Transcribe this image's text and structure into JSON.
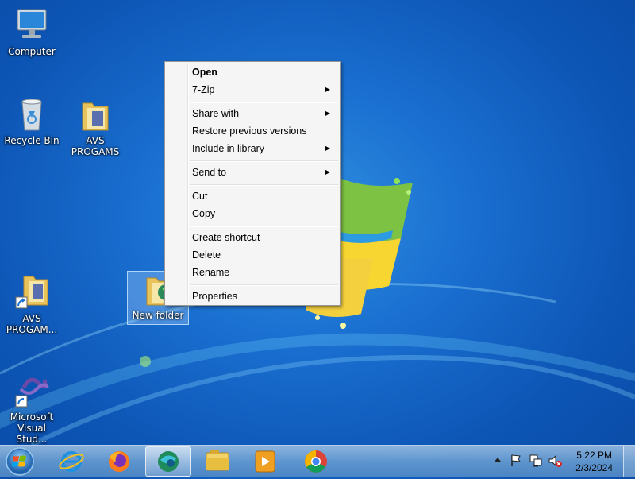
{
  "desktop": {
    "icons": [
      {
        "label": "Computer"
      },
      {
        "label": "Recycle Bin"
      },
      {
        "label": "AVS PROGAMS"
      },
      {
        "label": "AVS PROGAM..."
      },
      {
        "label": "New folder"
      },
      {
        "label": "Microsoft Visual Stud..."
      }
    ]
  },
  "context_menu": {
    "items": [
      {
        "label": "Open",
        "bold": true
      },
      {
        "label": "7-Zip",
        "submenu": true
      },
      {
        "label": "Share with",
        "submenu": true
      },
      {
        "label": "Restore previous versions"
      },
      {
        "label": "Include in library",
        "submenu": true
      },
      {
        "label": "Send to",
        "submenu": true
      },
      {
        "label": "Cut"
      },
      {
        "label": "Copy"
      },
      {
        "label": "Create shortcut"
      },
      {
        "label": "Delete"
      },
      {
        "label": "Rename"
      },
      {
        "label": "Properties"
      }
    ],
    "submenu_arrow": "▶"
  },
  "taskbar": {
    "pinned": [
      "internet-explorer-icon",
      "firefox-icon",
      "edge-icon",
      "file-explorer-icon",
      "media-player-icon",
      "chrome-icon"
    ],
    "clock": {
      "time": "5:22 PM",
      "date": "2/3/2024"
    }
  },
  "colors": {
    "desktop_blue": "#1a6fd0",
    "menu_bg": "#f5f5f5",
    "taskbar": "#7aa9d6"
  }
}
